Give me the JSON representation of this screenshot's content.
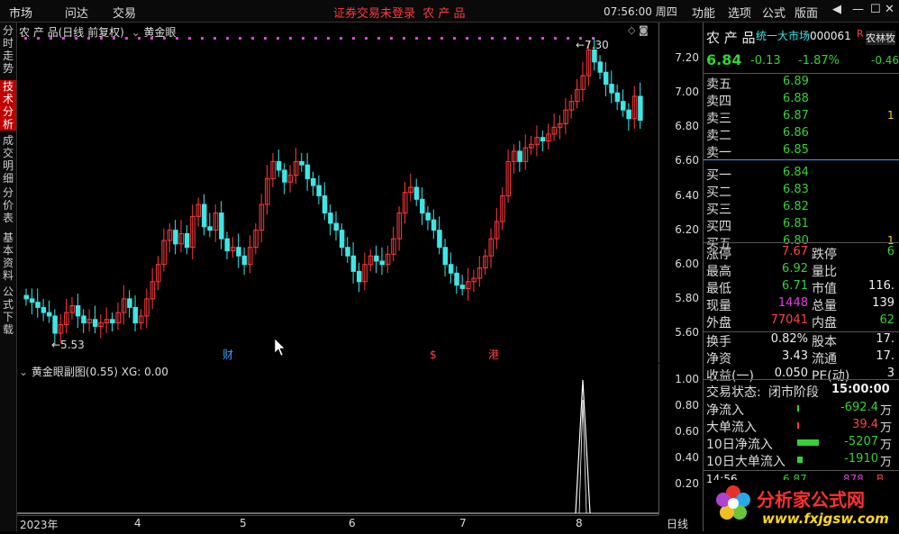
{
  "topbar": {
    "menus": [
      "市场",
      "问达",
      "交易"
    ],
    "status": "证券交易未登录",
    "stock_short": "农 产 品",
    "clock": "07:56:00 周四",
    "right_menus": [
      "功能",
      "选项",
      "公式",
      "版面"
    ],
    "controls": [
      "◀",
      "—",
      "☐",
      "✕"
    ]
  },
  "left_tabs": [
    {
      "label": "分时走势",
      "active": false
    },
    {
      "label": "技术分析",
      "active": true
    },
    {
      "label": "成交明细",
      "active": false
    },
    {
      "label": "分价表",
      "active": false
    },
    {
      "label": "基本资料",
      "active": false
    },
    {
      "label": "公式下载",
      "active": false
    }
  ],
  "main_chart": {
    "header": "农 产 品(日线 前复权)",
    "indicator": "黄金眼",
    "high_label": "7.30",
    "low_label": "5.53",
    "markers": [
      "财",
      "$",
      "港"
    ],
    "y_ticks": [
      "7.20",
      "7.00",
      "6.80",
      "6.60",
      "6.40",
      "6.20",
      "6.00",
      "5.80",
      "5.60"
    ],
    "ylim": [
      5.53,
      7.3
    ]
  },
  "sub_chart": {
    "header": "黄金眼副图(0.55) XG: 0.00",
    "y_ticks": [
      "1.00",
      "0.80",
      "0.60",
      "0.40",
      "0.20"
    ]
  },
  "x_axis": {
    "labels": [
      "2023年",
      "4",
      "5",
      "6",
      "7",
      "8"
    ],
    "period": "日线"
  },
  "quote": {
    "name": "农 产 品",
    "market": "统一大市场",
    "code": "000061",
    "tag": "R",
    "sector": "农林牧",
    "sector_pct": "-0.46",
    "price": "6.84",
    "change": "-0.13",
    "change_pct": "-1.87%",
    "asks": [
      {
        "label": "卖五",
        "price": "6.89",
        "vol": ""
      },
      {
        "label": "卖四",
        "price": "6.88",
        "vol": ""
      },
      {
        "label": "卖三",
        "price": "6.87",
        "vol": "1"
      },
      {
        "label": "卖二",
        "price": "6.86",
        "vol": ""
      },
      {
        "label": "卖一",
        "price": "6.85",
        "vol": ""
      }
    ],
    "bids": [
      {
        "label": "买一",
        "price": "6.84",
        "vol": ""
      },
      {
        "label": "买二",
        "price": "6.83",
        "vol": ""
      },
      {
        "label": "买三",
        "price": "6.82",
        "vol": ""
      },
      {
        "label": "买四",
        "price": "6.81",
        "vol": ""
      },
      {
        "label": "买五",
        "price": "6.80",
        "vol": "1"
      }
    ],
    "stats": [
      {
        "l1": "涨停",
        "v1": "7.67",
        "c1": "red",
        "l2": "跌停",
        "v2": "6",
        "c2": "grn"
      },
      {
        "l1": "最高",
        "v1": "6.92",
        "c1": "grn",
        "l2": "量比",
        "v2": "",
        "c2": "wht"
      },
      {
        "l1": "最低",
        "v1": "6.71",
        "c1": "grn",
        "l2": "市值",
        "v2": "116.",
        "c2": "wht"
      },
      {
        "l1": "现量",
        "v1": "1448",
        "c1": "mag",
        "l2": "总量",
        "v2": "139",
        "c2": "wht"
      },
      {
        "l1": "外盘",
        "v1": "77041",
        "c1": "red",
        "l2": "内盘",
        "v2": "62",
        "c2": "grn"
      },
      {
        "l1": "换手",
        "v1": "0.82%",
        "c1": "wht",
        "l2": "股本",
        "v2": "17.",
        "c2": "wht"
      },
      {
        "l1": "净资",
        "v1": "3.43",
        "c1": "wht",
        "l2": "流通",
        "v2": "17.",
        "c2": "wht"
      },
      {
        "l1": "收益(一)",
        "v1": "0.050",
        "c1": "wht",
        "l2": "PE(动)",
        "v2": "3",
        "c2": "wht"
      }
    ],
    "trade_state_label": "交易状态:",
    "trade_state": "闭市阶段",
    "trade_time": "15:00:00",
    "flows": [
      {
        "label": "净流入",
        "value": "-692.4",
        "unit": "万",
        "color": "grn"
      },
      {
        "label": "大单流入",
        "value": "39.4",
        "unit": "万",
        "color": "red"
      },
      {
        "label": "10日净流入",
        "value": "-5207",
        "unit": "万",
        "color": "grn"
      },
      {
        "label": "10日大单流入",
        "value": "-1910",
        "unit": "万",
        "color": "grn"
      }
    ],
    "tick": {
      "time": "14:56",
      "price": "6.87",
      "vol": "878",
      "dir": "B"
    }
  },
  "logo": {
    "cn": "分析家公式网",
    "url": "www.fxjgsw.com"
  },
  "colors": {
    "up": "#ff3b3b",
    "down": "#3ee6e6",
    "bg": "#000000",
    "accent_red": "#c00000"
  }
}
